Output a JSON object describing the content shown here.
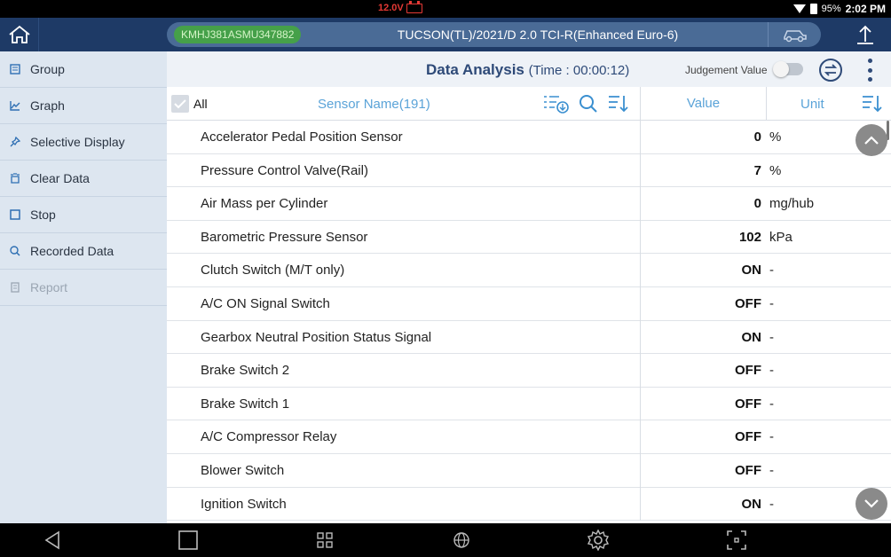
{
  "status_bar": {
    "voltage": "12.0V",
    "battery_percent": "95%",
    "clock": "2:02 PM"
  },
  "header": {
    "vin": "KMHJ381ASMU347882",
    "vehicle": "TUCSON(TL)/2021/D 2.0 TCI-R(Enhanced Euro-6)"
  },
  "sidebar": {
    "items": [
      {
        "label": "Group",
        "icon": "group-icon"
      },
      {
        "label": "Graph",
        "icon": "graph-icon"
      },
      {
        "label": "Selective Display",
        "icon": "pin-icon"
      },
      {
        "label": "Clear Data",
        "icon": "clear-icon"
      },
      {
        "label": "Stop",
        "icon": "stop-icon"
      },
      {
        "label": "Recorded Data",
        "icon": "recorded-icon"
      },
      {
        "label": "Report",
        "icon": "report-icon",
        "disabled": true
      }
    ]
  },
  "main": {
    "title": "Data Analysis",
    "time": "(Time : 00:00:12)",
    "judgement_label": "Judgement Value",
    "judgement_on": false,
    "columns": {
      "all": "All",
      "sensor_name": "Sensor Name(191)",
      "value": "Value",
      "unit": "Unit"
    },
    "rows": [
      {
        "name": "Accelerator Pedal Position Sensor",
        "value": "0",
        "unit": "%"
      },
      {
        "name": "Pressure Control Valve(Rail)",
        "value": "7",
        "unit": "%"
      },
      {
        "name": "Air Mass per Cylinder",
        "value": "0",
        "unit": "mg/hub"
      },
      {
        "name": "Barometric Pressure Sensor",
        "value": "102",
        "unit": "kPa"
      },
      {
        "name": "Clutch Switch (M/T only)",
        "value": "ON",
        "unit": "-"
      },
      {
        "name": "A/C ON Signal Switch",
        "value": "OFF",
        "unit": "-"
      },
      {
        "name": "Gearbox Neutral Position Status Signal",
        "value": "ON",
        "unit": "-"
      },
      {
        "name": "Brake Switch 2",
        "value": "OFF",
        "unit": "-"
      },
      {
        "name": "Brake Switch 1",
        "value": "OFF",
        "unit": "-"
      },
      {
        "name": "A/C Compressor Relay",
        "value": "OFF",
        "unit": "-"
      },
      {
        "name": "Blower Switch",
        "value": "OFF",
        "unit": "-"
      },
      {
        "name": "Ignition Switch",
        "value": "ON",
        "unit": "-"
      }
    ]
  },
  "colors": {
    "header_bg": "#1e3a66",
    "sidebar_bg": "#dde6f0",
    "accent": "#5aa3d8",
    "vin_green": "#45a049",
    "warning_red": "#e53935"
  }
}
